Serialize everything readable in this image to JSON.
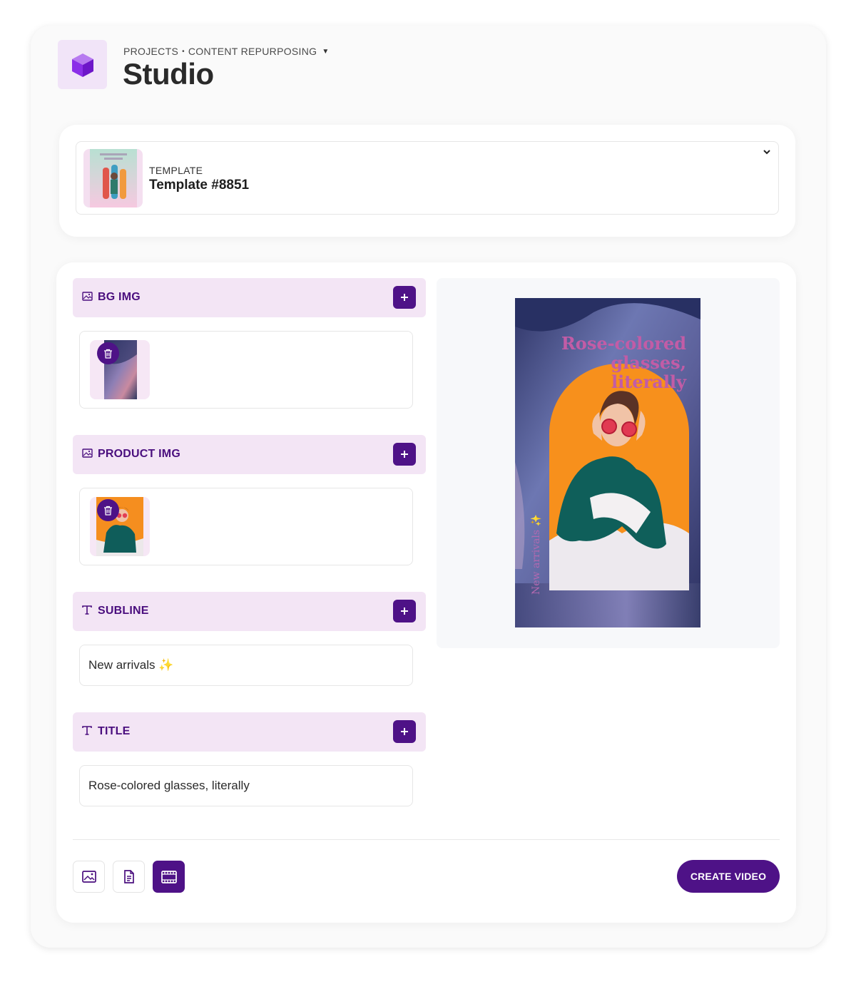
{
  "header": {
    "breadcrumb_project": "PROJECTS",
    "breadcrumb_section": "CONTENT REPURPOSING",
    "title": "Studio"
  },
  "template": {
    "label": "TEMPLATE",
    "name": "Template #8851"
  },
  "sections": [
    {
      "label": "BG IMG",
      "icon": "image-icon"
    },
    {
      "label": "PRODUCT IMG",
      "icon": "image-icon"
    },
    {
      "label": "SUBLINE",
      "icon": "text-icon",
      "value": "New arrivals ✨"
    },
    {
      "label": "TITLE",
      "icon": "text-icon",
      "value": "Rose-colored glasses, literally"
    }
  ],
  "preview": {
    "title_line1": "Rose-colored",
    "title_line2": "glasses, literally",
    "subline": "New arrivals ✨"
  },
  "footer": {
    "modes": [
      "image-mode-icon",
      "document-mode-icon",
      "video-mode-icon"
    ],
    "active_mode": "video-mode-icon",
    "create_label": "CREATE VIDEO"
  },
  "colors": {
    "accent": "#4e1287",
    "section_bg": "#f3e5f5",
    "logo_bg": "#f1e4f8",
    "preview_title": "#c25ca6"
  }
}
